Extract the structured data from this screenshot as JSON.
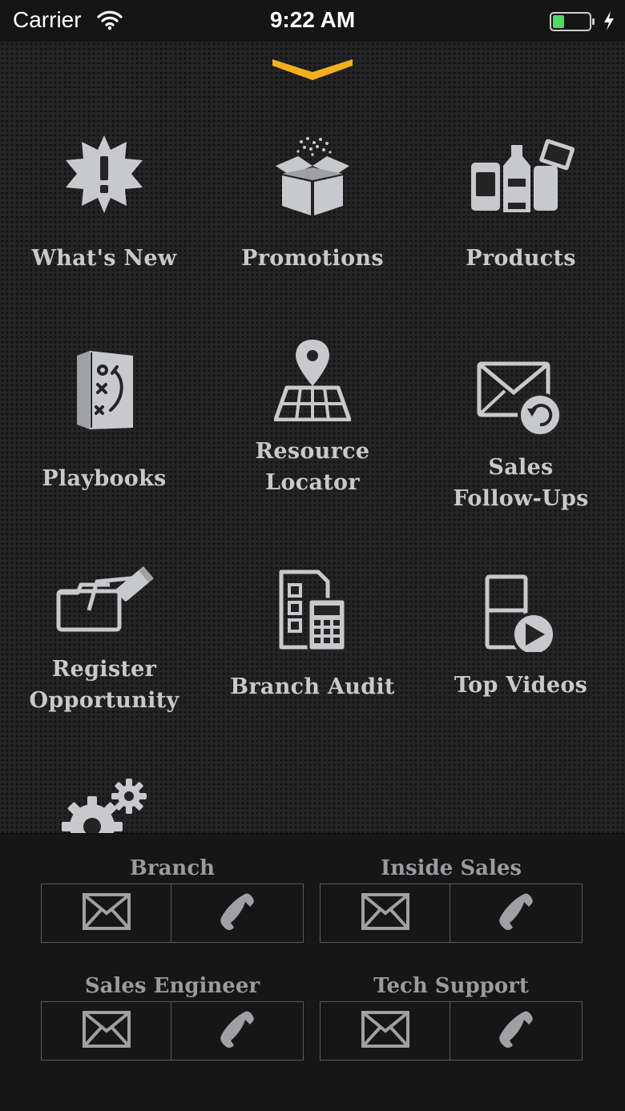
{
  "status_bar": {
    "carrier": "Carrier",
    "time": "9:22 AM",
    "battery_color": "#4cd964"
  },
  "menu": {
    "collapse_icon": "chevron-down-icon",
    "accent_color": "#f2b01e",
    "icon_color": "#c8c9cc",
    "tiles": [
      {
        "label": "What's New",
        "icon": "alert-burst-icon"
      },
      {
        "label": "Promotions",
        "icon": "open-box-icon"
      },
      {
        "label": "Products",
        "icon": "products-icon"
      },
      {
        "label": "Playbooks",
        "icon": "playbook-icon"
      },
      {
        "label_line1": "Resource",
        "label_line2": "Locator",
        "icon": "map-pin-icon"
      },
      {
        "label_line1": "Sales",
        "label_line2": "Follow-Ups",
        "icon": "mail-followup-icon"
      },
      {
        "label_line1": "Register",
        "label_line2": "Opportunity",
        "icon": "register-opportunity-icon"
      },
      {
        "label": "Branch Audit",
        "icon": "checklist-calculator-icon"
      },
      {
        "label": "Top Videos",
        "icon": "video-play-icon"
      },
      {
        "label": "",
        "icon": "settings-gears-icon"
      }
    ]
  },
  "contacts": [
    {
      "title": "Branch",
      "email_icon": "envelope-icon",
      "phone_icon": "phone-icon"
    },
    {
      "title": "Inside Sales",
      "email_icon": "envelope-icon",
      "phone_icon": "phone-icon"
    },
    {
      "title": "Sales Engineer",
      "email_icon": "envelope-icon",
      "phone_icon": "phone-icon"
    },
    {
      "title": "Tech Support",
      "email_icon": "envelope-icon",
      "phone_icon": "phone-icon"
    }
  ]
}
